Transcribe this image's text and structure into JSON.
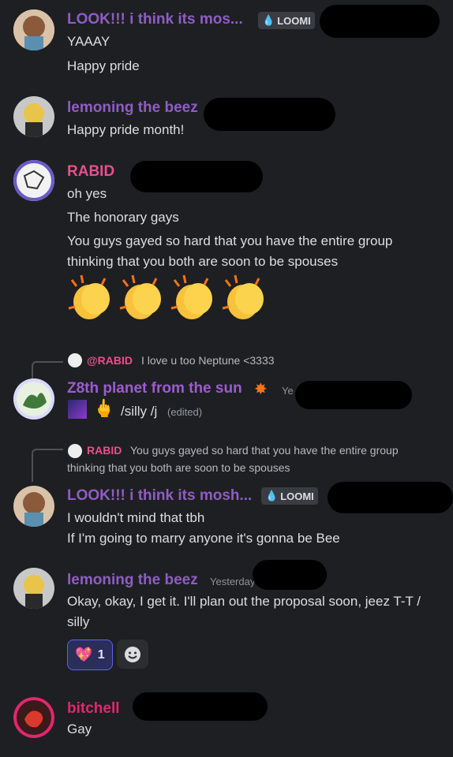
{
  "colors": {
    "background": "#1e1f22",
    "name_purple": "#8e5dc4",
    "name_rabid": "#e8508f",
    "name_z8th": "#9c5bd3",
    "name_bitchell": "#e3266f",
    "reaction_border": "#5865f2"
  },
  "messages": [
    {
      "author": "LOOK!!! i think its  mos...",
      "tag": "LOOMI",
      "lines": [
        "YAAAY",
        "Happy pride"
      ]
    },
    {
      "author": "lemoning the beez",
      "lines": [
        "Happy pride month!"
      ]
    },
    {
      "author": "RABID",
      "lines": [
        "oh yes",
        "The honorary gays",
        "You guys gayed so hard that you have the entire group",
        "thinking that you both are soon to be spouses"
      ],
      "emoji": "clap"
    },
    {
      "reply": {
        "author": "@RABID",
        "text": "I love u too Neptune <3333"
      },
      "author": "Z8th planet from the sun",
      "timestamp_partial": "Ye",
      "lines": [
        "/silly /j"
      ],
      "edited": "(edited)"
    },
    {
      "reply": {
        "author": "RABID",
        "text": "You guys gayed so hard that you have the entire group",
        "text2": "thinking that you both are soon to be spouses"
      },
      "author": "LOOK!!! i think its  mosh...",
      "tag": "LOOMI",
      "lines": [
        "I wouldn't mind that tbh",
        "If I'm going to marry anyone it's gonna be Bee"
      ]
    },
    {
      "author": "lemoning the beez",
      "timestamp_partial": "Yesterday",
      "lines": [
        "Okay, okay, I get it. I'll plan out the proposal soon, jeez T-T /",
        "silly"
      ],
      "reaction": {
        "emoji": "sparkling-heart",
        "count": "1"
      }
    },
    {
      "author": "bitchell",
      "lines": [
        "Gay"
      ]
    }
  ]
}
